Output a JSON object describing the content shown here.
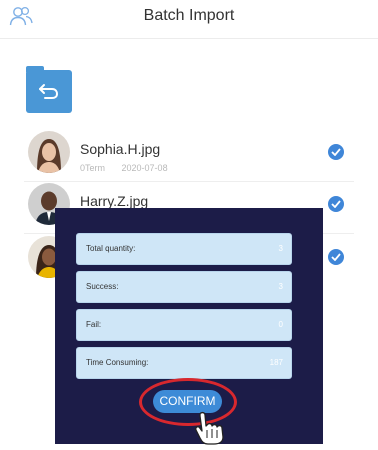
{
  "header": {
    "title": "Batch Import",
    "icon": "users-icon"
  },
  "toolbar": {
    "back_icon": "folder-return-icon"
  },
  "files": [
    {
      "name": "Sophia.H.jpg",
      "meta": [
        "0Term",
        "2020-07-08"
      ],
      "checked": true
    },
    {
      "name": "Harry.Z.jpg",
      "meta": [],
      "checked": true
    },
    {
      "name": "",
      "meta": [],
      "checked": true
    }
  ],
  "dialog": {
    "fields": [
      {
        "label": "Total quantity:",
        "value": "3"
      },
      {
        "label": "Success:",
        "value": "3"
      },
      {
        "label": "Fail:",
        "value": "0"
      },
      {
        "label": "Time Consuming:",
        "value": "187"
      }
    ],
    "confirm_label": "CONFIRM"
  },
  "colors": {
    "accent": "#3d8bd7",
    "dialog_bg": "#1c1c48",
    "field_bg": "#cfe6f7",
    "highlight": "#d8282e"
  }
}
